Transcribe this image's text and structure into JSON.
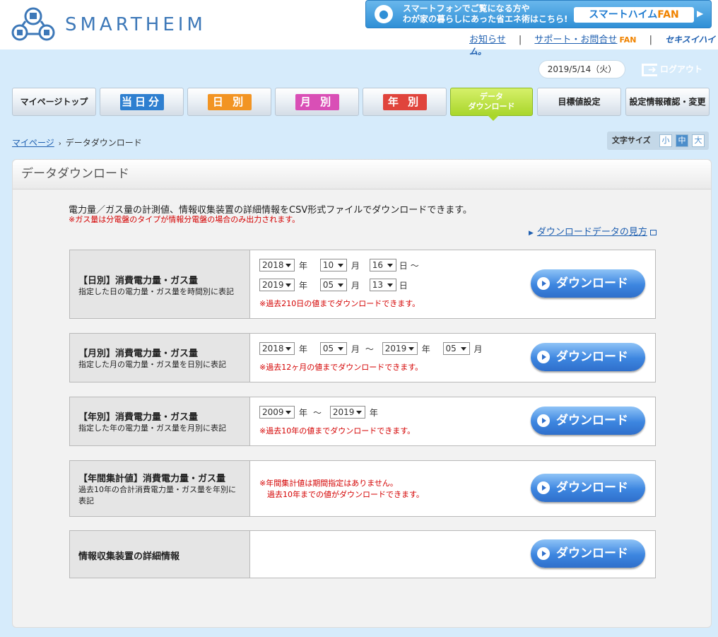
{
  "header": {
    "logo_text": "SMARTHEIM",
    "banner": {
      "line1": "スマートフォンでご覧になる方や",
      "line2": "わが家の暮らしにあった省エネ術はこちら!",
      "brand": "スマートハイム",
      "brand_suffix": "FAN",
      "arrow": "▶"
    },
    "links": {
      "news": "お知らせ",
      "support": "サポート・お問合せ",
      "support_suffix": "FAN",
      "sep": "|",
      "sekisui": "セキスイハイム。"
    }
  },
  "status": {
    "date": "2019/5/14（火）",
    "logout": "ログアウト"
  },
  "nav": {
    "mypage_top": "マイページトップ",
    "today": "当日分",
    "daily": "日 別",
    "monthly": "月 別",
    "yearly": "年 別",
    "download_line1": "データ",
    "download_line2": "ダウンロード",
    "target": "目標値設定",
    "settings": "設定情報確認・変更",
    "colors": {
      "today": "#2e7fd0",
      "daily": "#f29423",
      "monthly": "#d94fb6",
      "yearly": "#e0443c"
    }
  },
  "breadcrumb": {
    "home": "マイページ",
    "chevron": "›",
    "current": "データダウンロード"
  },
  "fontsize": {
    "label": "文字サイズ",
    "small": "小",
    "medium": "中",
    "large": "大"
  },
  "panel": {
    "title": "データダウンロード",
    "intro": "電力量／ガス量の計測値、情報収集装置の詳細情報をCSV形式ファイルでダウンロードできます。",
    "note": "※ガス量は分電盤のタイプが情報分電盤の場合のみ出力されます。",
    "howto": "ダウンロードデータの見方"
  },
  "rows": {
    "daily": {
      "title": "【日別】消費電力量・ガス量",
      "desc": "指定した日の電力量・ガス量を時間別に表記",
      "from": {
        "year": "2018",
        "month": "10",
        "day": "16"
      },
      "to": {
        "year": "2019",
        "month": "05",
        "day": "13"
      },
      "note": "※過去210日の値までダウンロードできます。"
    },
    "monthly": {
      "title": "【月別】消費電力量・ガス量",
      "desc": "指定した月の電力量・ガス量を日別に表記",
      "from": {
        "year": "2018",
        "month": "05"
      },
      "to": {
        "year": "2019",
        "month": "05"
      },
      "note": "※過去12ヶ月の値までダウンロードできます。"
    },
    "yearly": {
      "title": "【年別】消費電力量・ガス量",
      "desc": "指定した年の電力量・ガス量を月別に表記",
      "from": {
        "year": "2009"
      },
      "to": {
        "year": "2019"
      },
      "note": "※過去10年の値までダウンロードできます。"
    },
    "annual": {
      "title": "【年間集計値】消費電力量・ガス量",
      "desc_line1": "過去10年の合計消費電力量・ガス量を年別に",
      "desc_line2": "表記",
      "note_line1": "※年間集計値は期間指定はありません。",
      "note_line2": "過去10年までの値がダウンロードできます。"
    },
    "device": {
      "title": "情報収集装置の詳細情報"
    }
  },
  "units": {
    "year": "年",
    "month": "月",
    "day": "日",
    "range": "～"
  },
  "download_label": "ダウンロード"
}
